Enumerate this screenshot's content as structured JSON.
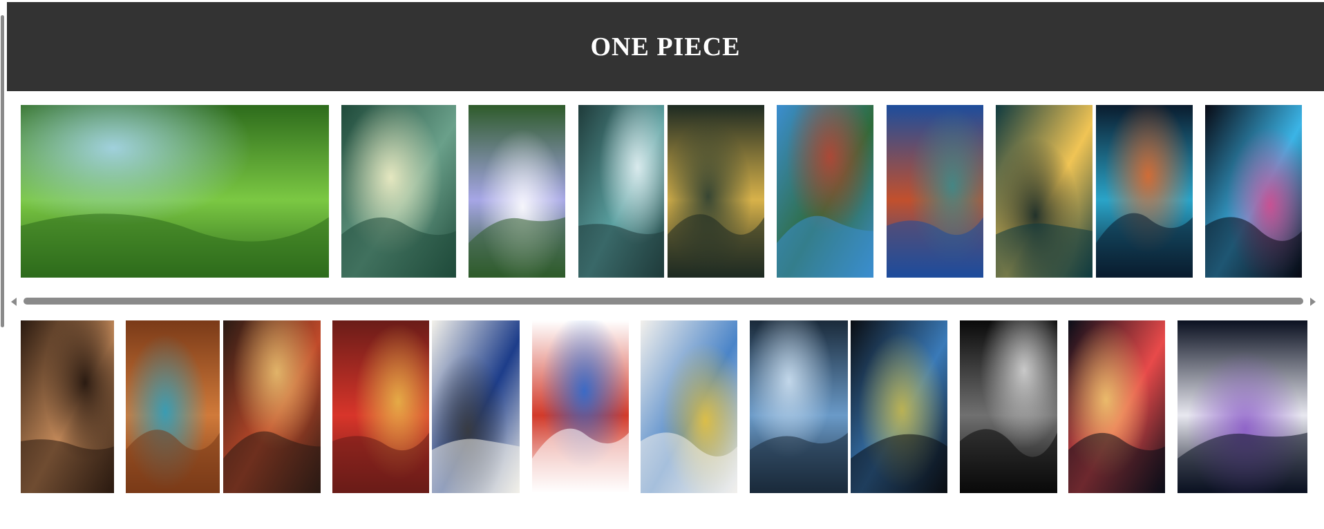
{
  "page": {
    "title": "ONE PIECE",
    "header_bg": "#333333",
    "header_text_color": "#ffffff"
  },
  "gallery": {
    "row1": [
      {
        "name": "leaf-water-droplets-image",
        "colors": [
          "#2d6b1c",
          "#7bc843",
          "#a9d7f0"
        ]
      },
      {
        "name": "forest-light-bokeh-image",
        "colors": [
          "#1f4a3a",
          "#6aa08a",
          "#f4f1c8"
        ]
      },
      {
        "name": "waterfall-image",
        "colors": [
          "#2e5b2a",
          "#a6a6e6",
          "#ffffff"
        ]
      },
      {
        "name": "waterfall-bonsai-image",
        "colors": [
          "#1f3b3a",
          "#5aa0a0",
          "#e7f2f5"
        ]
      },
      {
        "name": "moon-valley-image",
        "colors": [
          "#1d2a22",
          "#d8b24a",
          "#263a30"
        ]
      },
      {
        "name": "mountain-train-image",
        "colors": [
          "#3b8ed0",
          "#2e6b3a",
          "#b84433"
        ]
      },
      {
        "name": "golden-gate-bridge-image",
        "colors": [
          "#1d4d9c",
          "#c2502d",
          "#3a8c8c"
        ]
      },
      {
        "name": "lamp-post-rain-image",
        "colors": [
          "#0f3a40",
          "#f0c455",
          "#0c2226"
        ]
      },
      {
        "name": "code-screen-image",
        "colors": [
          "#0a1c2e",
          "#2aa4c8",
          "#e36a2b"
        ]
      },
      {
        "name": "data-tunnel-image",
        "colors": [
          "#080a14",
          "#3bb4e6",
          "#d84a8e"
        ]
      }
    ],
    "row2": [
      {
        "name": "boombox-shelves-image",
        "colors": [
          "#2a1a10",
          "#c48a5a",
          "#1a0f0a"
        ]
      },
      {
        "name": "retro-room-radio-image",
        "colors": [
          "#7a3a18",
          "#d07a3a",
          "#2aa0c0"
        ]
      },
      {
        "name": "vinyl-wall-guitar-image",
        "colors": [
          "#2a1a14",
          "#c04a2a",
          "#e8c070"
        ]
      },
      {
        "name": "poster-bedroom-image",
        "colors": [
          "#6a1c18",
          "#d8352a",
          "#e8b84a"
        ]
      },
      {
        "name": "ink-sketch-portrait-image",
        "colors": [
          "#f3f1ea",
          "#1d3d8a",
          "#3a3a3a"
        ]
      },
      {
        "name": "spiderman-sketch-image",
        "colors": [
          "#ffffff",
          "#d23a2a",
          "#2a6ad0"
        ]
      },
      {
        "name": "krishna-flute-sketch-image",
        "colors": [
          "#f2f0ec",
          "#4a84c8",
          "#e8c23a"
        ]
      },
      {
        "name": "warrior-cosmic-cloud-image",
        "colors": [
          "#1a2a3a",
          "#6a9ac8",
          "#cfe2f3"
        ]
      },
      {
        "name": "glowing-figure-image",
        "colors": [
          "#0a0d12",
          "#3a7ab8",
          "#c8b84a"
        ]
      },
      {
        "name": "black-hole-debris-image",
        "colors": [
          "#0a0a0a",
          "#707070",
          "#d8d8d8"
        ]
      },
      {
        "name": "astronaut-warp-image",
        "colors": [
          "#0a0d18",
          "#e84a4a",
          "#f0c870"
        ]
      },
      {
        "name": "glitch-astronaut-image",
        "colors": [
          "#0a1020",
          "#e8e8f0",
          "#8a5ac8"
        ]
      }
    ]
  }
}
